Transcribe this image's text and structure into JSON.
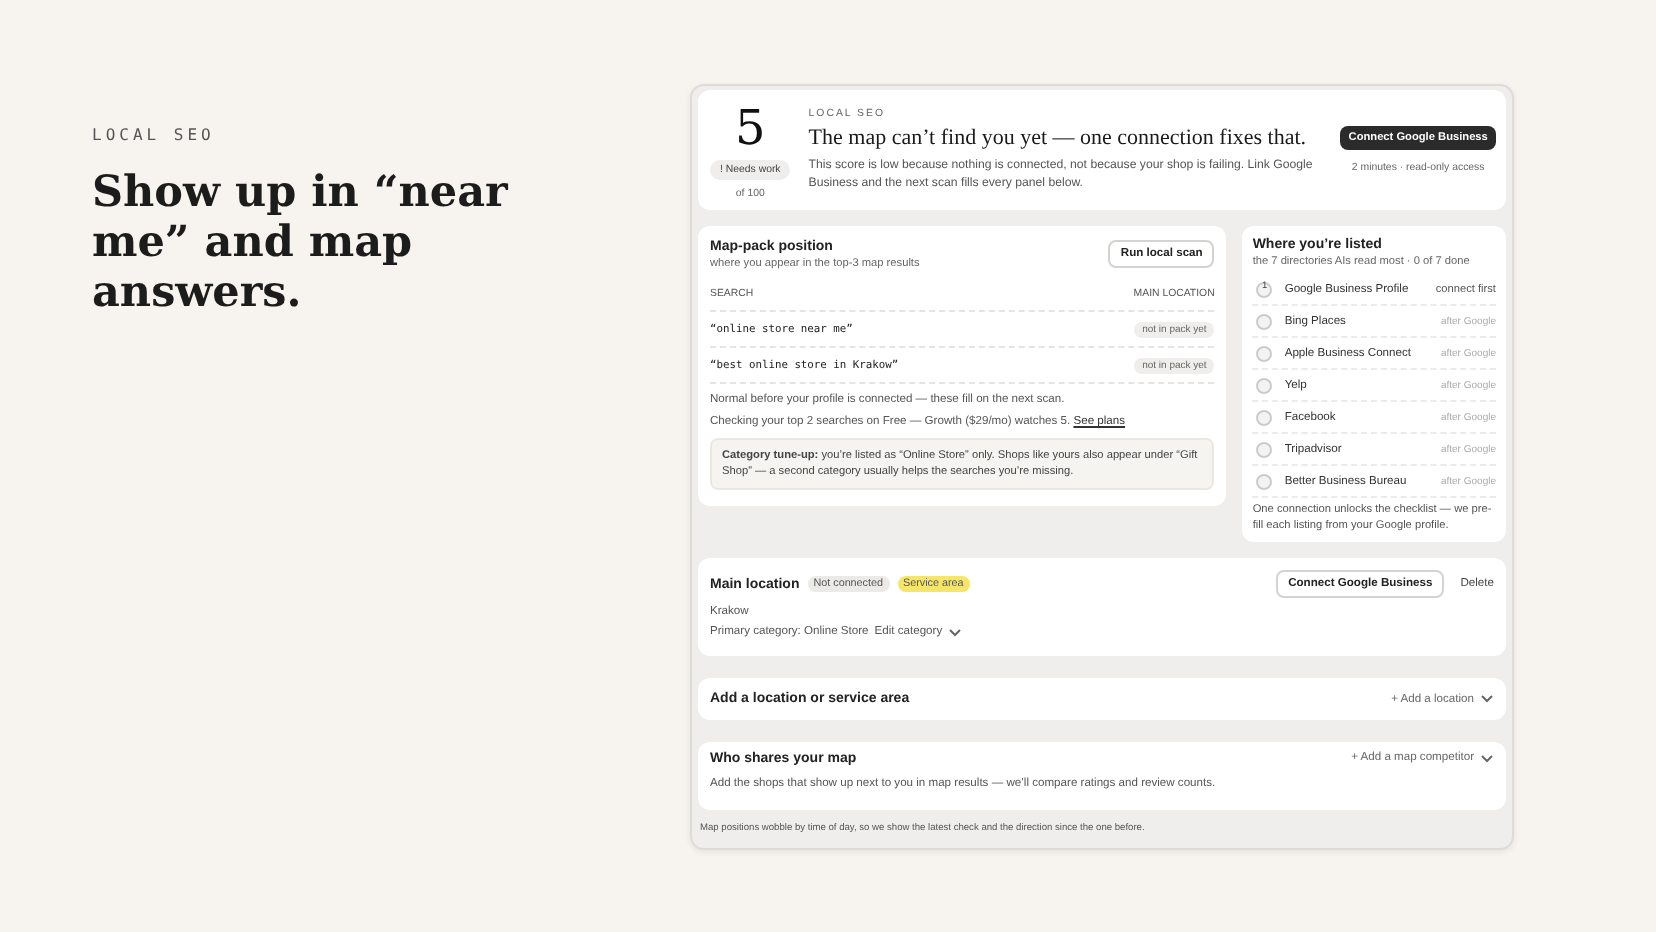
{
  "hero": {
    "eyebrow": "LOCAL SEO",
    "title": "Show up in “near me” and map answers."
  },
  "score": {
    "value": "5",
    "badge": "! Needs work",
    "scale": "of 100",
    "eyebrow": "LOCAL SEO",
    "headline": "The map can’t find you yet — one connection fixes that.",
    "body": "This score is low because nothing is connected, not because your shop is failing. Link Google Business and the next scan fills every panel below.",
    "button": "Connect Google Business",
    "note": "2 minutes · read-only access"
  },
  "map_pack": {
    "title": "Map-pack position",
    "subtitle": "where you appear in the top-3 map results",
    "button": "Run local scan",
    "columns": [
      "SEARCH",
      "MAIN LOCATION"
    ],
    "rows": [
      {
        "search": "“online store near me”",
        "status": "not in pack yet"
      },
      {
        "search": "“best online store in Krakow”",
        "status": "not in pack yet"
      }
    ],
    "note": "Normal before your profile is connected — these fill on the next scan.",
    "plan_note": "Checking your top 2 searches on Free — Growth ($29/mo) watches 5.",
    "plan_link": "See plans",
    "tip": "**Category tune-up:** you’re listed as “Online Store” only. Shops like yours also appear under “Gift Shop” — a second category usually helps the searches you’re missing."
  },
  "directories": {
    "title": "Where you’re listed",
    "subtitle": "the 7 directories AIs read most · 0 of 7 done",
    "items": [
      {
        "kind": "step",
        "marker": "1",
        "name": "Google Business Profile",
        "status": "connect first"
      },
      {
        "kind": "pending",
        "name": "Bing Places",
        "status": "after Google"
      },
      {
        "kind": "pending",
        "name": "Apple Business Connect",
        "status": "after Google"
      },
      {
        "kind": "pending",
        "name": "Yelp",
        "status": "after Google"
      },
      {
        "kind": "pending",
        "name": "Facebook",
        "status": "after Google"
      },
      {
        "kind": "pending",
        "name": "Tripadvisor",
        "status": "after Google"
      },
      {
        "kind": "pending",
        "name": "Better Business Bureau",
        "status": "after Google"
      }
    ],
    "note": "One connection unlocks the checklist — we pre-fill each listing from your Google profile."
  },
  "main_location": {
    "title": "Main location",
    "tags": [
      {
        "label": "Not connected",
        "color": "#ebeae7"
      },
      {
        "label": "Service area",
        "color": "#f5e66b"
      }
    ],
    "button": "Connect Google Business",
    "delete": "Delete",
    "city": "Krakow",
    "category": "Primary category: Online Store",
    "edit": "Edit category"
  },
  "add_location": {
    "title": "Add a location or service area",
    "action": "+ Add a location"
  },
  "competitors": {
    "title": "Who shares your map",
    "action": "+ Add a map competitor",
    "body": "Add the shops that show up next to you in map results — we’ll compare ratings and review counts."
  },
  "footnote": "Map positions wobble by time of day, so we show the latest check and the direction since the one before."
}
